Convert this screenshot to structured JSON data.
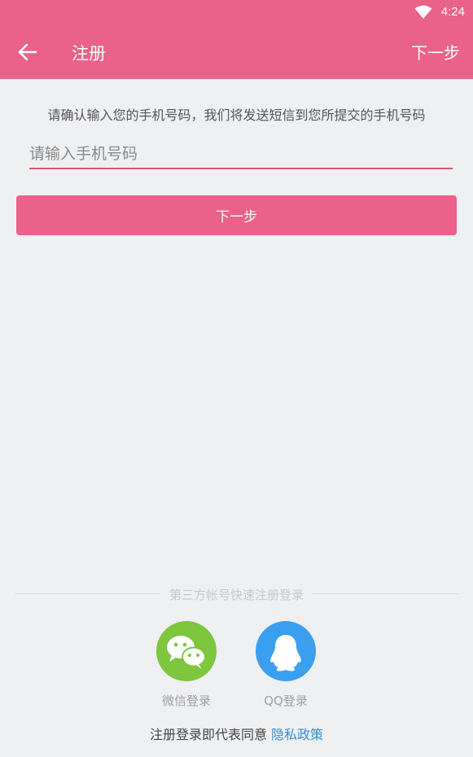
{
  "status_bar": {
    "time": "4:24",
    "wifi_icon": "wifi-icon"
  },
  "app_bar": {
    "back_icon": "arrow-left-icon",
    "title": "注册",
    "next_label": "下一步"
  },
  "form": {
    "hint": "请确认输入您的手机号码，我们将发送短信到您所提交的手机号码",
    "phone_placeholder": "请输入手机号码",
    "phone_value": "",
    "next_button": "下一步"
  },
  "third_party": {
    "label": "第三方帐号快速注册登录",
    "wechat_label": "微信登录",
    "qq_label": "QQ登录"
  },
  "agreement": {
    "prefix": "注册登录即代表同意 ",
    "policy_link": "隐私政策"
  },
  "colors": {
    "primary": "#ea6289",
    "wechat": "#7dc63e",
    "qq": "#3b9ff0",
    "link": "#2d8fd5"
  }
}
